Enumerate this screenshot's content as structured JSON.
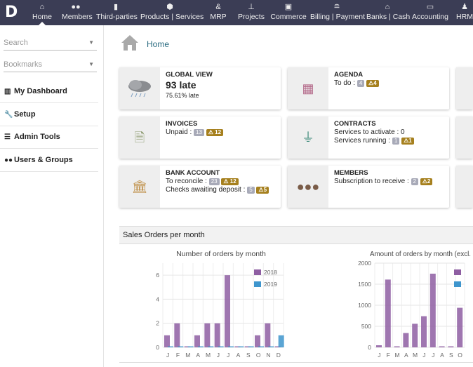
{
  "topbar": {
    "logo": "D",
    "items": [
      {
        "label": "Home",
        "icon": "home-icon",
        "ic": "⌂"
      },
      {
        "label": "Members",
        "icon": "users-icon",
        "ic": "●●"
      },
      {
        "label": "Third-parties",
        "icon": "building-icon",
        "ic": "▮"
      },
      {
        "label": "Products | Services",
        "icon": "cube-icon",
        "ic": "⬢"
      },
      {
        "label": "MRP",
        "icon": "cubes-icon",
        "ic": "&"
      },
      {
        "label": "Projects",
        "icon": "sitemap-icon",
        "ic": "⊥"
      },
      {
        "label": "Commerce",
        "icon": "suitcase-icon",
        "ic": "▣"
      },
      {
        "label": "Billing | Payment",
        "icon": "coins-icon",
        "ic": "≘"
      },
      {
        "label": "Banks | Cash",
        "icon": "bank-icon",
        "ic": "⌂"
      },
      {
        "label": "Accounting",
        "icon": "money-check-icon",
        "ic": "▭"
      },
      {
        "label": "HRM",
        "icon": "user-tie-icon",
        "ic": "♟"
      }
    ]
  },
  "sidebar": {
    "search_placeholder": "Search",
    "bookmarks_placeholder": "Bookmarks",
    "items": [
      {
        "label": "My Dashboard",
        "icon": "chart-icon",
        "ic": "▥"
      },
      {
        "label": "Setup",
        "icon": "wrench-icon",
        "ic": "🔧"
      },
      {
        "label": "Admin Tools",
        "icon": "server-icon",
        "ic": "☰"
      },
      {
        "label": "Users & Groups",
        "icon": "users-icon",
        "ic": "●●"
      }
    ]
  },
  "breadcrumb": {
    "title": "Home"
  },
  "cards": {
    "global": {
      "title": "GLOBAL VIEW",
      "big": "93 late",
      "sub": "75.61% late"
    },
    "agenda": {
      "title": "AGENDA",
      "line1": "To do :",
      "c1": "4",
      "w1": "⚠4"
    },
    "invoices": {
      "title": "INVOICES",
      "line1": "Unpaid :",
      "c1": "13",
      "w1": "⚠ 12"
    },
    "contracts": {
      "title": "CONTRACTS",
      "line1": "Services to activate : 0",
      "line2": "Services running :",
      "c2": "1",
      "w2": "⚠1"
    },
    "bank": {
      "title": "BANK ACCOUNT",
      "line1": "To reconcile :",
      "c1": "23",
      "w1": "⚠ 12",
      "line2": "Checks awaiting deposit :",
      "c2": "5",
      "w2": "⚠5"
    },
    "members": {
      "title": "MEMBERS",
      "line1": "Subscription to receive :",
      "c1": "2",
      "w1": "⚠2"
    }
  },
  "sales": {
    "title": "Sales Orders per month"
  },
  "colors": {
    "2018": "#8e5ea2",
    "2019": "#3e95cd",
    "topbar": "#3b3d55"
  },
  "chart_data": [
    {
      "type": "bar",
      "title": "Number of orders by month",
      "categories": [
        "J",
        "F",
        "M",
        "A",
        "M",
        "J",
        "J",
        "A",
        "S",
        "O",
        "N",
        "D"
      ],
      "ylim": [
        0,
        7
      ],
      "yticks": [
        0,
        2,
        4,
        6
      ],
      "grid": true,
      "legend": "top-right",
      "series": [
        {
          "name": "2018",
          "values": [
            1,
            2,
            0,
            1,
            2,
            2,
            6,
            0,
            0,
            1,
            2,
            0
          ]
        },
        {
          "name": "2019",
          "values": [
            0,
            0,
            0,
            0,
            0,
            0,
            0,
            0,
            0,
            0,
            0,
            1
          ]
        }
      ]
    },
    {
      "type": "bar",
      "title": "Amount of orders by month (excl.",
      "categories": [
        "J",
        "F",
        "M",
        "A",
        "M",
        "J",
        "J",
        "A",
        "S",
        "O"
      ],
      "ylim": [
        0,
        2000
      ],
      "yticks": [
        0,
        500,
        1000,
        1500,
        2000
      ],
      "grid": true,
      "legend": "top-right",
      "series": [
        {
          "values": [
            50,
            1610,
            0,
            340,
            560,
            740,
            1750,
            0,
            0,
            940
          ]
        }
      ]
    }
  ]
}
